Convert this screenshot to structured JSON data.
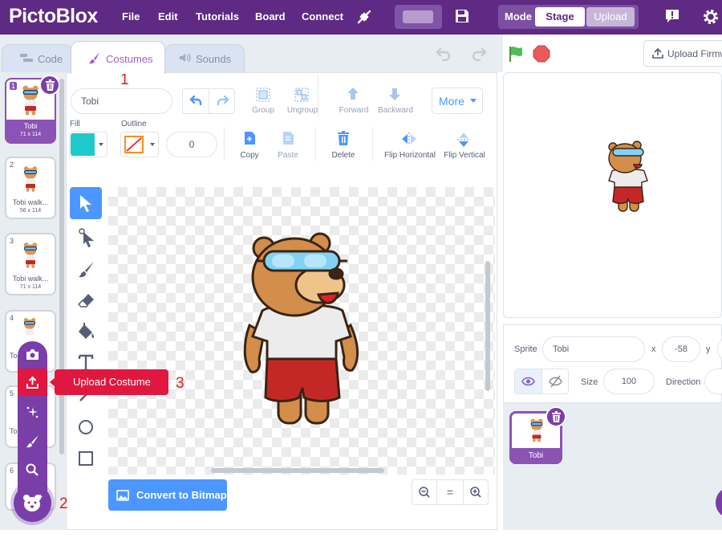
{
  "menubar": {
    "logo": "PictoBlox",
    "items": [
      "File",
      "Edit",
      "Tutorials",
      "Board",
      "Connect"
    ],
    "mode_label": "Mode",
    "mode_stage": "Stage",
    "mode_upload": "Upload"
  },
  "tabs": {
    "code": "Code",
    "costumes": "Costumes",
    "sounds": "Sounds"
  },
  "upload_firmware": "Upload Firmw",
  "costumes": [
    {
      "num": "1",
      "name": "Tobi",
      "size": "71 x 114"
    },
    {
      "num": "2",
      "name": "Tobi walk...",
      "size": "56 x 114"
    },
    {
      "num": "3",
      "name": "Tobi walk...",
      "size": "71 x 114"
    },
    {
      "num": "4",
      "name": "To"
    },
    {
      "num": "5",
      "name": "To"
    },
    {
      "num": "6",
      "name": ""
    }
  ],
  "editor": {
    "costume_name": "Tobi",
    "group": "Group",
    "ungroup": "Ungroup",
    "forward": "Forward",
    "backward": "Backward",
    "more": "More",
    "fill_label": "Fill",
    "outline_label": "Outline",
    "outline_width": "0",
    "copy": "Copy",
    "paste": "Paste",
    "delete": "Delete",
    "flip_h": "Flip Horizontal",
    "flip_v": "Flip Vertical",
    "fill_color": "#1fc9c9",
    "convert_bitmap": "Convert to Bitmap",
    "zoom_reset": "="
  },
  "floating_menu": {
    "tooltip": "Upload Costume",
    "items": [
      "camera-icon",
      "upload-icon",
      "surprise-icon",
      "paint-icon",
      "search-icon"
    ]
  },
  "annotations": {
    "a1": "1",
    "a2": "2",
    "a3": "3"
  },
  "sprite_info": {
    "sprite_label": "Sprite",
    "sprite_name": "Tobi",
    "x_label": "x",
    "x_value": "-58",
    "y_label": "y",
    "size_label": "Size",
    "size_value": "100",
    "direction_label": "Direction"
  },
  "sprite_tile": {
    "name": "Tobi"
  },
  "colors": {
    "brand": "#5e2a84",
    "accent": "#4c97ff",
    "highlight": "#e0173f"
  }
}
